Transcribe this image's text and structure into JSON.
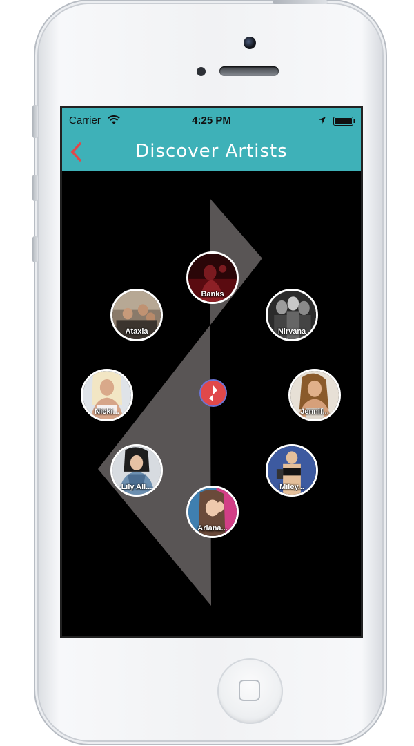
{
  "statusbar": {
    "carrier": "Carrier",
    "time": "4:25 PM"
  },
  "navbar": {
    "title": "Discover Artists",
    "back_icon": "chevron-left-icon"
  },
  "colors": {
    "accent": "#3eb1b8",
    "back": "#e0484a",
    "logo": "#e0484a",
    "shape": "#5e5a5a",
    "bubble_border": "#ffffff"
  },
  "center": {
    "icon": "app-logo-icon"
  },
  "artists": [
    {
      "name": "Banks"
    },
    {
      "name": "Nirvana"
    },
    {
      "name": "Jennif..."
    },
    {
      "name": "Miley..."
    },
    {
      "name": "Ariana..."
    },
    {
      "name": "Lily All..."
    },
    {
      "name": "Nicki..."
    },
    {
      "name": "Ataxia"
    }
  ]
}
